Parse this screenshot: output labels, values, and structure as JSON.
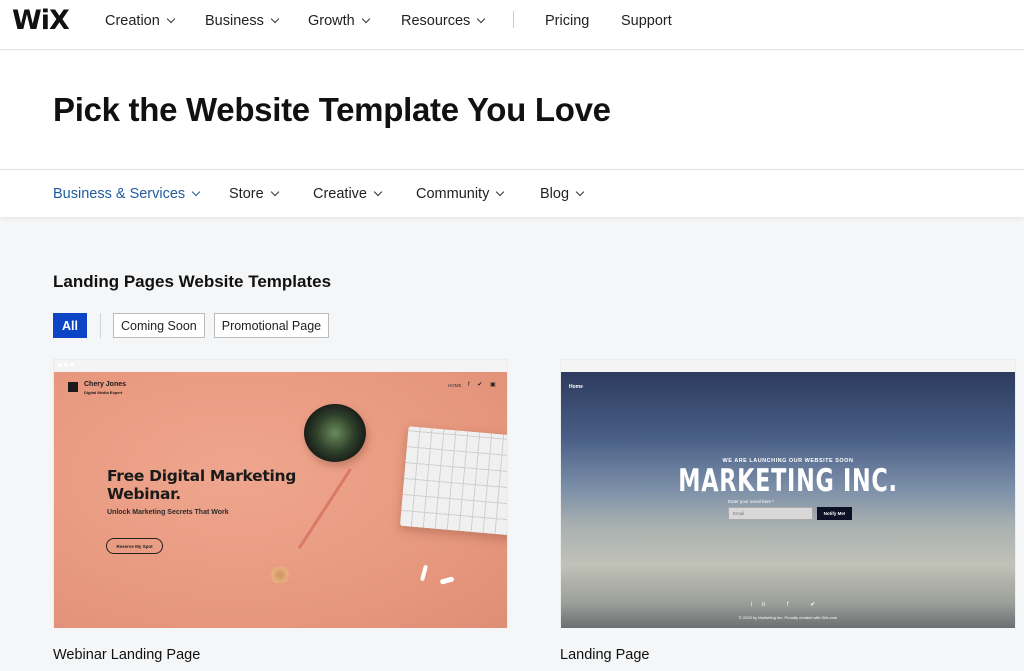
{
  "topnav": {
    "logo": "WiX",
    "items": [
      {
        "label": "Creation",
        "dropdown": true
      },
      {
        "label": "Business",
        "dropdown": true
      },
      {
        "label": "Growth",
        "dropdown": true
      },
      {
        "label": "Resources",
        "dropdown": true
      },
      {
        "label": "Pricing",
        "dropdown": false
      },
      {
        "label": "Support",
        "dropdown": false
      }
    ]
  },
  "hero": {
    "title": "Pick the Website Template You Love"
  },
  "categories": {
    "active_color": "#1d5b9e",
    "items": [
      {
        "label": "Business & Services",
        "active": true
      },
      {
        "label": "Store",
        "active": false
      },
      {
        "label": "Creative",
        "active": false
      },
      {
        "label": "Community",
        "active": false
      },
      {
        "label": "Blog",
        "active": false
      }
    ]
  },
  "section": {
    "title": "Landing Pages Website Templates",
    "filters": [
      {
        "label": "All",
        "active": true
      },
      {
        "label": "Coming Soon",
        "active": false
      },
      {
        "label": "Promotional Page",
        "active": false
      }
    ],
    "filter_active_color": "#0b44c4"
  },
  "templates": [
    {
      "name": "Webinar Landing Page",
      "preview": {
        "brand_name": "Chery Jones",
        "brand_sub": "Digital Media Expert",
        "nav_home": "HOME",
        "social": "f ✔ ▣",
        "headline_1": "Free Digital Marketing",
        "headline_2": "Webinar.",
        "subhead": "Unlock Marketing Secrets That Work",
        "cta": "Reserve My Spot",
        "bg_color": "#e89a80"
      }
    },
    {
      "name": "Landing Page",
      "preview": {
        "nav_home": "Home",
        "tagline": "WE ARE LAUNCHING OUR WEBSITE SOON",
        "title": "MARKETING INC.",
        "email_label": "Enter your email here *",
        "email_placeholder": "Email",
        "cta": "Notify Me!",
        "social": "in f ✔",
        "footer": "© 2023 by Marketing Inc. Proudly created with Wix.com"
      }
    }
  ]
}
